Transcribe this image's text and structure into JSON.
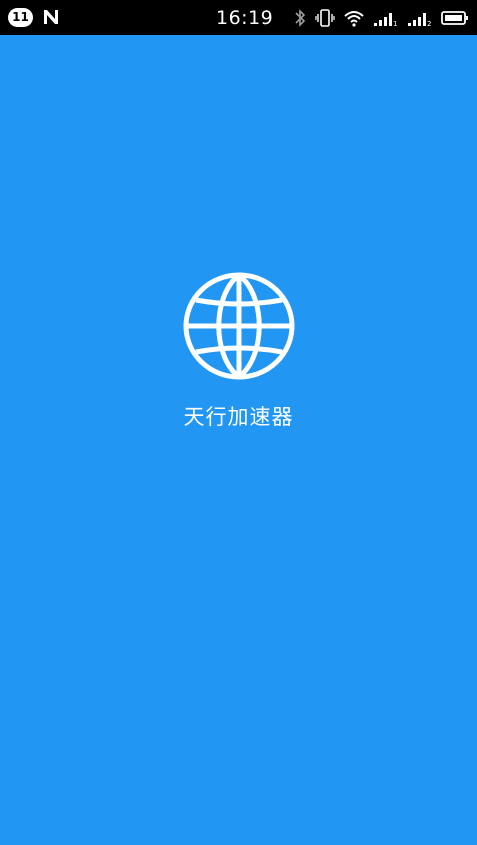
{
  "status_bar": {
    "notification_count": "11",
    "time": "16:19",
    "icons": [
      "n-logo-icon",
      "bluetooth-icon",
      "vibrate-icon",
      "wifi-icon",
      "signal-1-icon",
      "signal-2-icon",
      "battery-icon"
    ]
  },
  "app": {
    "name": "天行加速器",
    "logo_icon": "globe-icon"
  },
  "colors": {
    "background": "#2196F3",
    "status_bar": "#000000",
    "foreground": "#FFFFFF"
  }
}
